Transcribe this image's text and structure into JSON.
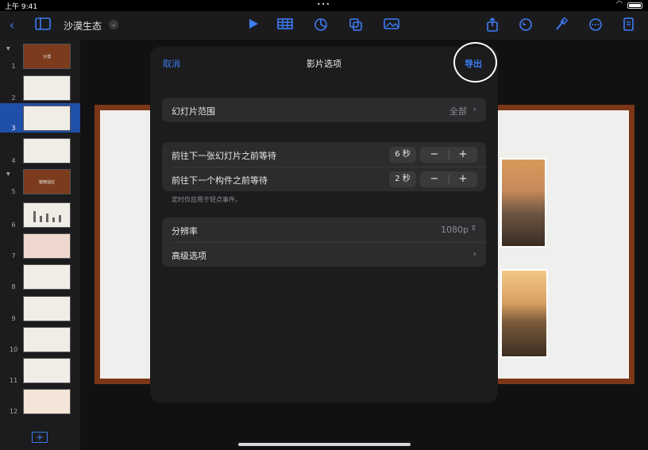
{
  "status": {
    "time": "上午 9:41"
  },
  "toolbar": {
    "doc_title": "沙漠生态"
  },
  "sidebar": {
    "slides": [
      {
        "num": "1",
        "thumb_text": "沙漠"
      },
      {
        "num": "2"
      },
      {
        "num": "3"
      },
      {
        "num": "4"
      },
      {
        "num": "5",
        "thumb_text": "植物适应"
      },
      {
        "num": "6"
      },
      {
        "num": "7"
      },
      {
        "num": "8"
      },
      {
        "num": "9"
      },
      {
        "num": "10"
      },
      {
        "num": "11"
      },
      {
        "num": "12"
      }
    ]
  },
  "modal": {
    "cancel": "取消",
    "title": "影片选项",
    "export": "导出",
    "slide_range_label": "幻灯片范围",
    "slide_range_value": "全部",
    "next_slide_label": "前往下一张幻灯片之前等待",
    "next_slide_value": "6 秒",
    "next_build_label": "前往下一个构件之前等待",
    "next_build_value": "2 秒",
    "footnote": "定时仅应用于轻点事件。",
    "resolution_label": "分辨率",
    "resolution_value": "1080p",
    "advanced_label": "高级选项",
    "stepper_minus": "−",
    "stepper_plus": "+"
  },
  "colors": {
    "accent": "#3d7cf5",
    "panel": "#1c1c1e",
    "row": "#2c2c2e"
  }
}
